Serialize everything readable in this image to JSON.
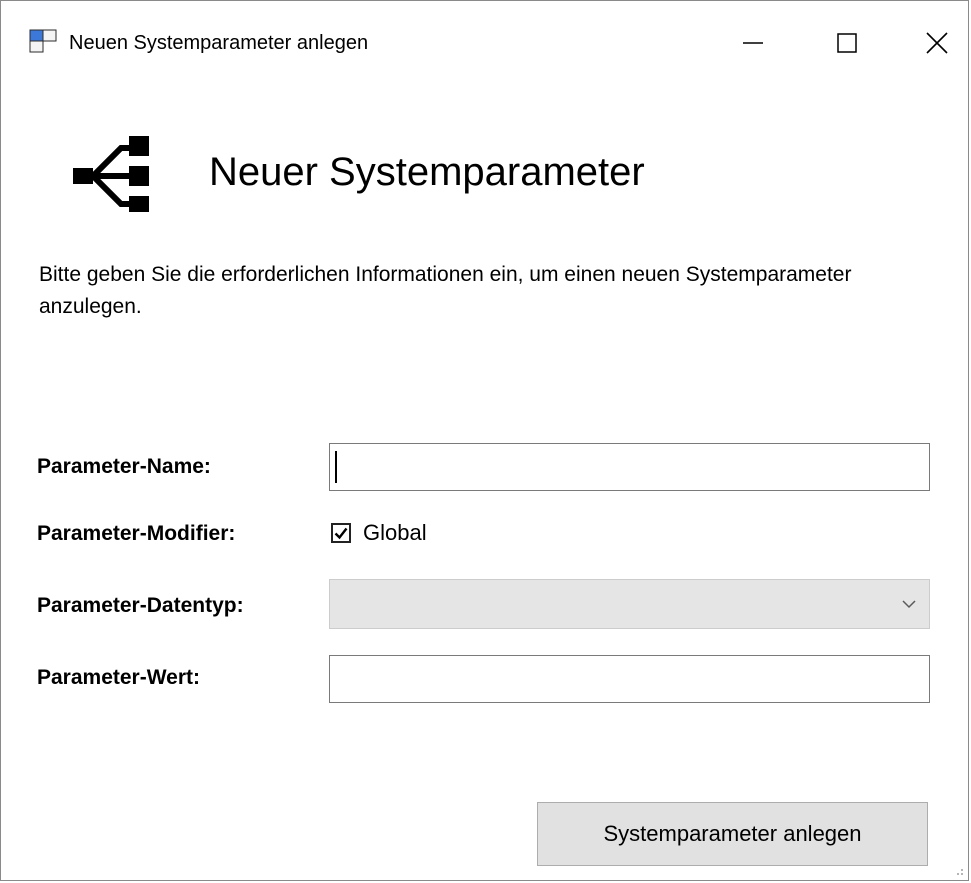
{
  "window": {
    "title": "Neuen Systemparameter anlegen",
    "icon": "window-app-icon",
    "controls": {
      "minimize_icon": "minimize-icon",
      "maximize_icon": "maximize-icon",
      "close_icon": "close-icon"
    }
  },
  "header": {
    "icon": "usb-symbol-icon",
    "title": "Neuer Systemparameter",
    "description": "Bitte geben Sie die erforderlichen Informationen ein, um einen neuen Systemparameter anzulegen."
  },
  "form": {
    "name": {
      "label": "Parameter-Name:",
      "value": ""
    },
    "modifier": {
      "label": "Parameter-Modifier:",
      "checkbox_label": "Global",
      "checked": true
    },
    "datatype": {
      "label": "Parameter-Datentyp:",
      "selected": "",
      "enabled": false,
      "arrow_icon": "chevron-down-icon"
    },
    "value": {
      "label": "Parameter-Wert:",
      "value": ""
    }
  },
  "actions": {
    "submit_label": "Systemparameter anlegen"
  },
  "colors": {
    "button_background": "#e1e1e1",
    "disabled_combo_background": "#e5e5e5",
    "input_border": "#7a7a7a"
  }
}
